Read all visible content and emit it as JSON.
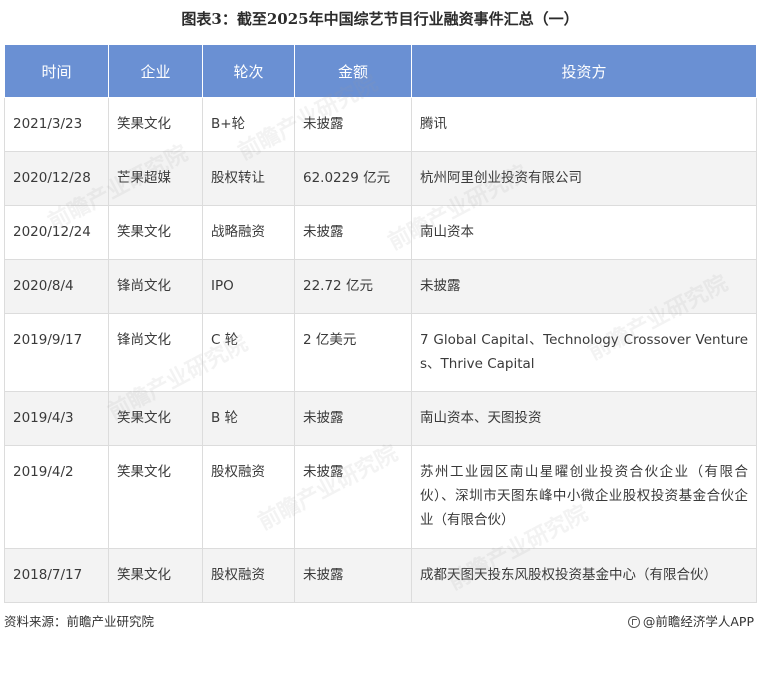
{
  "title": "图表3：截至2025年中国综艺节目行业融资事件汇总（一）",
  "table": {
    "headers": [
      "时间",
      "企业",
      "轮次",
      "金额",
      "投资方"
    ],
    "rows": [
      {
        "time": "2021/3/23",
        "company": "笑果文化",
        "round": "B+轮",
        "amount": "未披露",
        "investor": "腾讯"
      },
      {
        "time": "2020/12/28",
        "company": "芒果超媒",
        "round": "股权转让",
        "amount": "62.0229 亿元",
        "investor": "杭州阿里创业投资有限公司"
      },
      {
        "time": "2020/12/24",
        "company": "笑果文化",
        "round": "战略融资",
        "amount": "未披露",
        "investor": "南山资本"
      },
      {
        "time": "2020/8/4",
        "company": "锋尚文化",
        "round": "IPO",
        "amount": "22.72 亿元",
        "investor": "未披露"
      },
      {
        "time": "2019/9/17",
        "company": "锋尚文化",
        "round": "C 轮",
        "amount": "2 亿美元",
        "investor": "7 Global Capital、Technology Crossover Ventures、Thrive Capital"
      },
      {
        "time": "2019/4/3",
        "company": "笑果文化",
        "round": "B 轮",
        "amount": "未披露",
        "investor": "南山资本、天图投资"
      },
      {
        "time": "2019/4/2",
        "company": "笑果文化",
        "round": "股权融资",
        "amount": "未披露",
        "investor": "苏州工业园区南山星曜创业投资合伙企业（有限合伙）、深圳市天图东峰中小微企业股权投资基金合伙企业（有限合伙）"
      },
      {
        "time": "2018/7/17",
        "company": "笑果文化",
        "round": "股权融资",
        "amount": "未披露",
        "investor": "成都天图天投东风股权投资基金中心（有限合伙）"
      }
    ]
  },
  "footer": {
    "source": "资料来源：前瞻产业研究院",
    "brand": "@前瞻经济学人APP"
  },
  "watermark": {
    "text": "前瞻产业研究院"
  }
}
